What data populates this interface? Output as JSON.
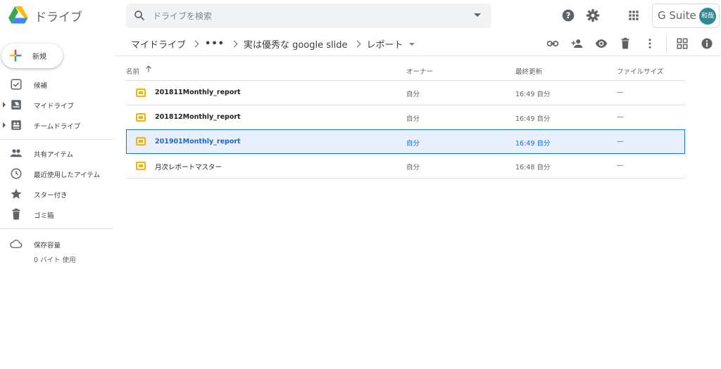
{
  "app": {
    "title": "ドライブ"
  },
  "search": {
    "placeholder": "ドライブを検索"
  },
  "header": {
    "gsuite_label": "G Suite",
    "avatar_text": "和哉"
  },
  "breadcrumb": {
    "root": "マイドライブ",
    "more": "•••",
    "folder": "実は優秀な google slide",
    "current": "レポート"
  },
  "sidebar": {
    "new_label": "新規",
    "items": [
      {
        "label": "候補",
        "icon": "check-box-icon"
      },
      {
        "label": "マイドライブ",
        "icon": "my-drive-icon"
      },
      {
        "label": "チームドライブ",
        "icon": "team-drive-icon"
      },
      {
        "label": "共有アイテム",
        "icon": "shared-people-icon"
      },
      {
        "label": "最近使用したアイテム",
        "icon": "clock-icon"
      },
      {
        "label": "スター付き",
        "icon": "star-icon"
      },
      {
        "label": "ゴミ箱",
        "icon": "trash-icon"
      },
      {
        "label": "保存容量",
        "icon": "cloud-icon"
      }
    ],
    "storage_used": "0 バイト 使用"
  },
  "table": {
    "columns": {
      "name": "名前",
      "owner": "オーナー",
      "modified": "最終更新",
      "size": "ファイルサイズ"
    },
    "rows": [
      {
        "name": "201811Monthly_report",
        "owner": "自分",
        "modified": "16:49 自分",
        "size": "—"
      },
      {
        "name": "201812Monthly_report",
        "owner": "自分",
        "modified": "16:49 自分",
        "size": "—"
      },
      {
        "name": "201901Monthly_report",
        "owner": "自分",
        "modified": "16:49 自分",
        "size": "—"
      },
      {
        "name": "月次レポートマスター",
        "owner": "自分",
        "modified": "16:48 自分",
        "size": "—"
      }
    ],
    "selected_index": 2
  },
  "colors": {
    "accent": "#1a73e8",
    "selected_bg": "#e8f0fe",
    "slides_yellow": "#f4b400",
    "avatar": "#2b8a92"
  }
}
